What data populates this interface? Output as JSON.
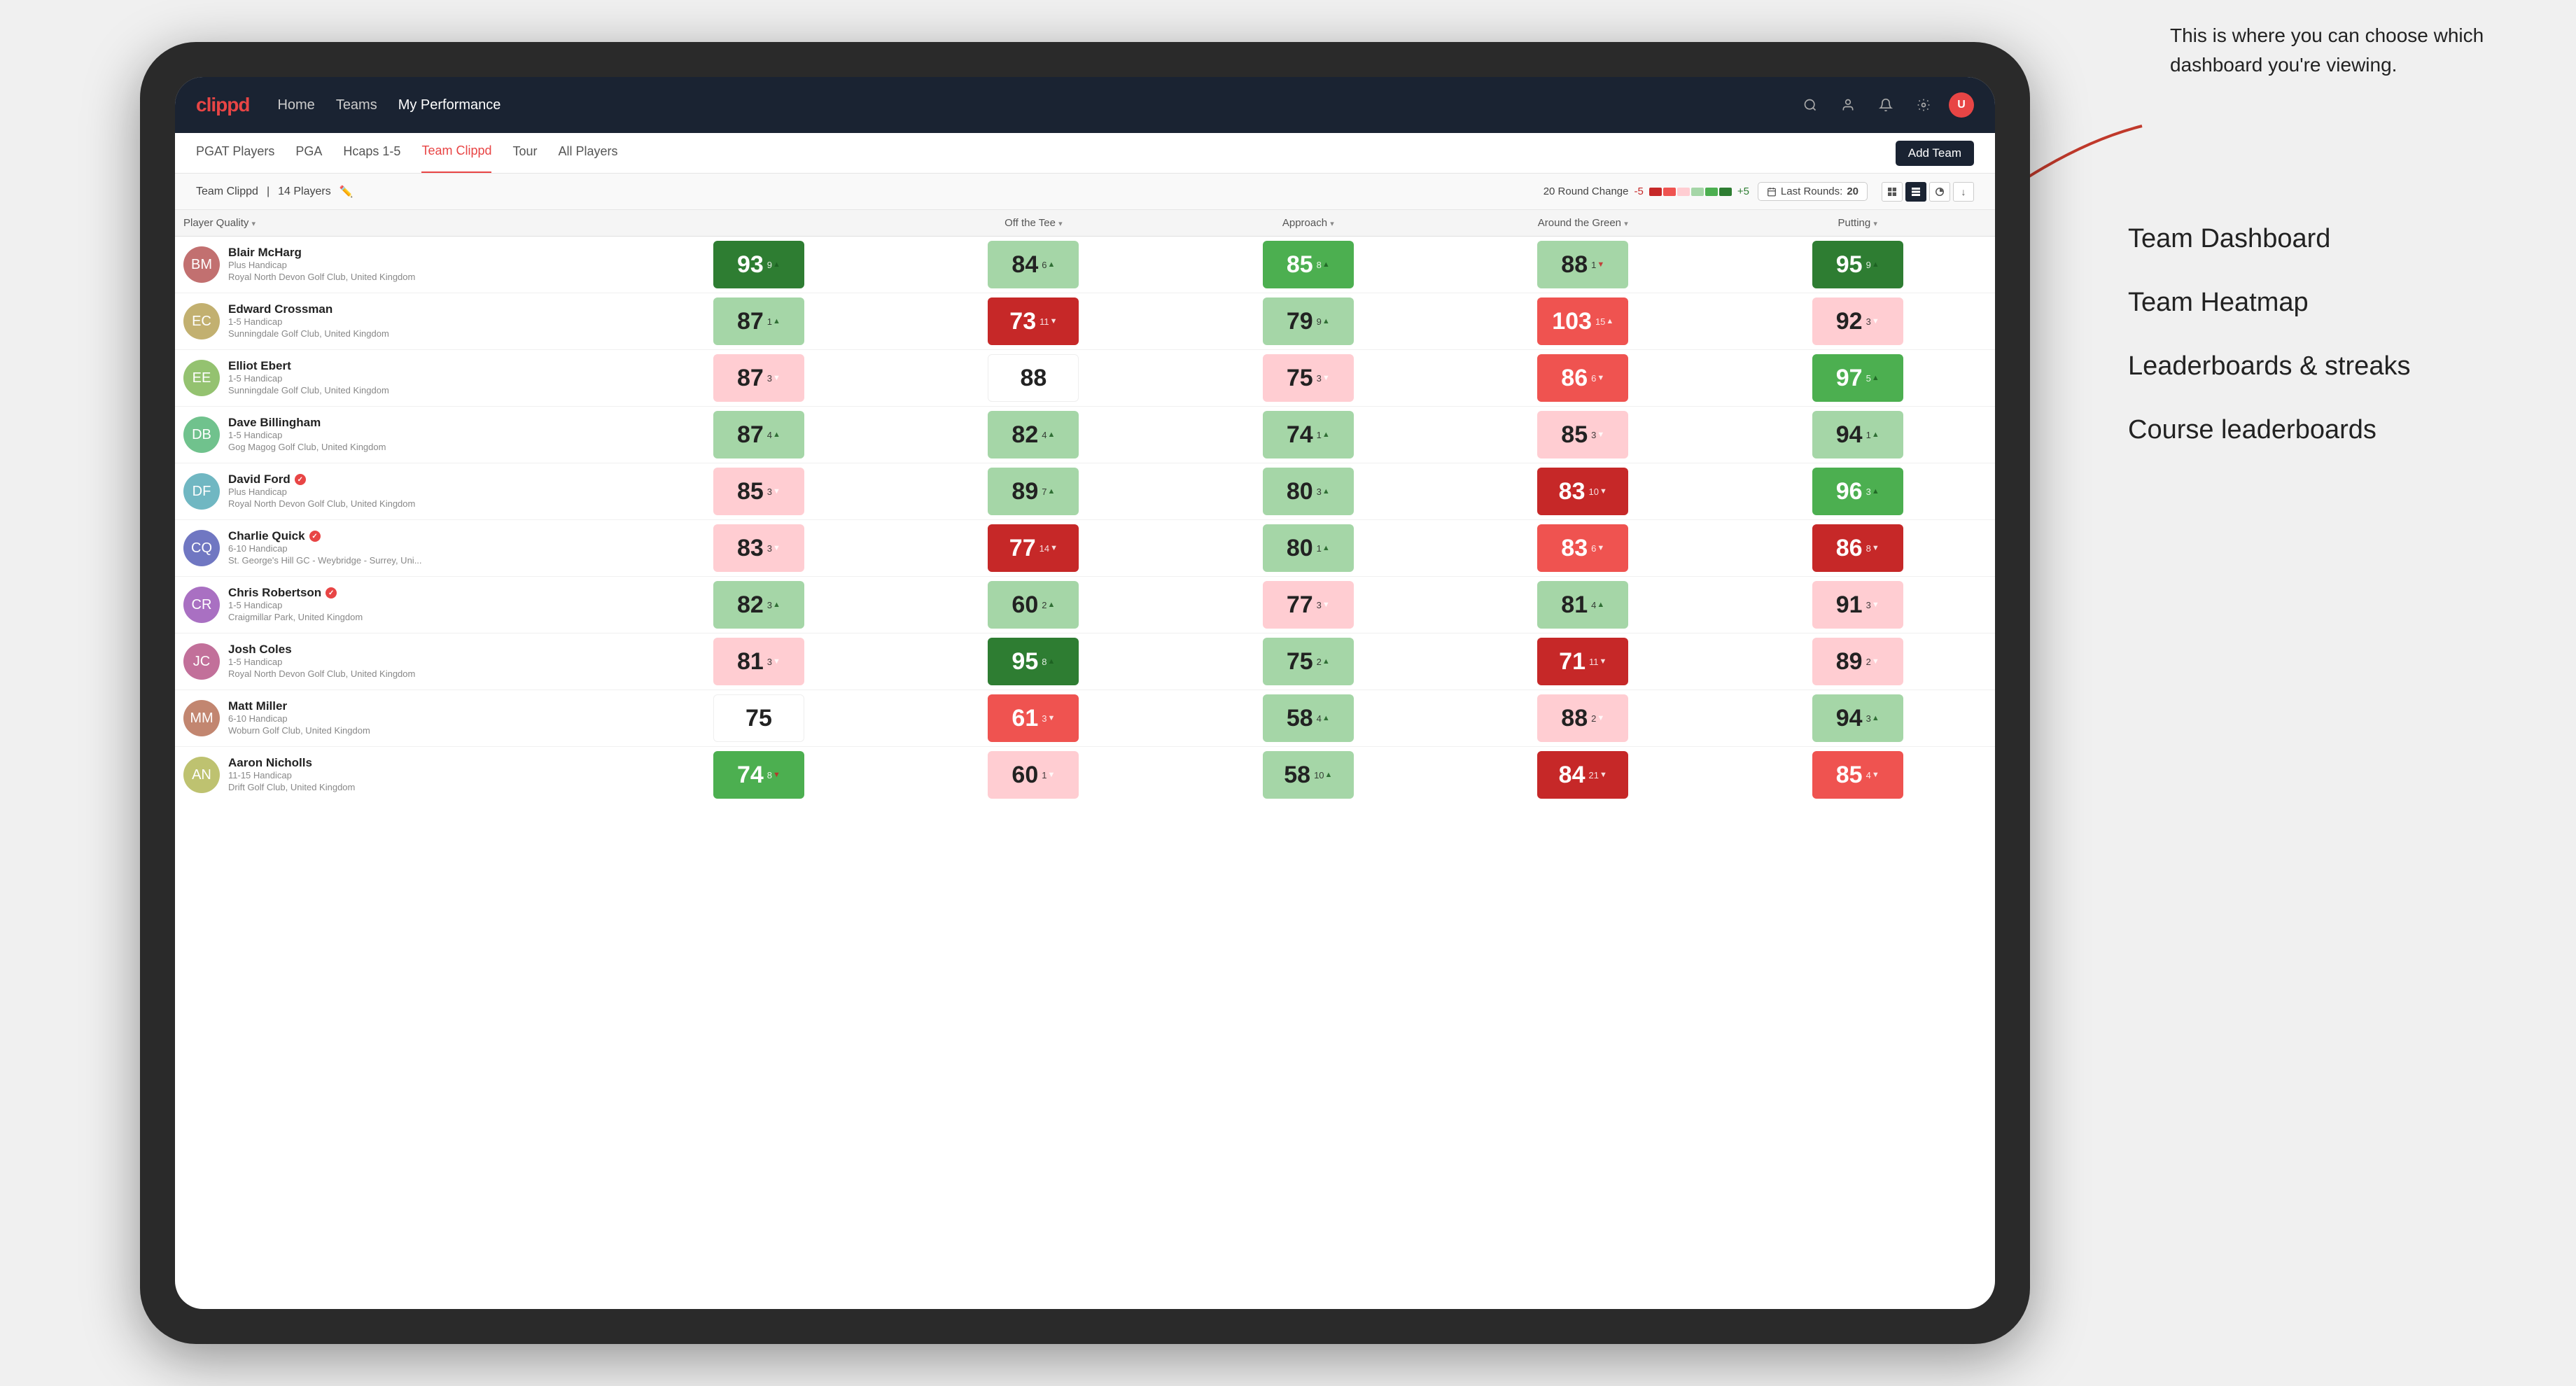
{
  "annotation": {
    "text": "This is where you can choose which dashboard you're viewing.",
    "options": [
      "Team Dashboard",
      "Team Heatmap",
      "Leaderboards & streaks",
      "Course leaderboards"
    ]
  },
  "nav": {
    "logo": "clippd",
    "items": [
      "Home",
      "Teams",
      "My Performance"
    ],
    "active": "My Performance"
  },
  "subnav": {
    "items": [
      "PGAT Players",
      "PGA",
      "Hcaps 1-5",
      "Team Clippd",
      "Tour",
      "All Players"
    ],
    "active": "Team Clippd",
    "add_team_label": "Add Team"
  },
  "team_header": {
    "name": "Team Clippd",
    "count": "14 Players",
    "round_change_label": "20 Round Change",
    "range_low": "-5",
    "range_high": "+5",
    "last_rounds_label": "Last Rounds:",
    "last_rounds_value": "20"
  },
  "columns": {
    "player": "Player Quality",
    "tee": "Off the Tee",
    "approach": "Approach",
    "around": "Around the Green",
    "putting": "Putting"
  },
  "players": [
    {
      "name": "Blair McHarg",
      "handicap": "Plus Handicap",
      "club": "Royal North Devon Golf Club, United Kingdom",
      "verified": false,
      "scores": {
        "quality": {
          "val": 93,
          "change": "+9",
          "dir": "up",
          "bg": "green-dark"
        },
        "tee": {
          "val": 84,
          "change": "+6",
          "dir": "up",
          "bg": "green-light"
        },
        "approach": {
          "val": 85,
          "change": "+8",
          "dir": "up",
          "bg": "green-mid"
        },
        "around": {
          "val": 88,
          "change": "-1",
          "dir": "down",
          "bg": "green-light"
        },
        "putting": {
          "val": 95,
          "change": "+9",
          "dir": "up",
          "bg": "green-dark"
        }
      }
    },
    {
      "name": "Edward Crossman",
      "handicap": "1-5 Handicap",
      "club": "Sunningdale Golf Club, United Kingdom",
      "verified": false,
      "scores": {
        "quality": {
          "val": 87,
          "change": "+1",
          "dir": "up",
          "bg": "green-light"
        },
        "tee": {
          "val": 73,
          "change": "-11",
          "dir": "down",
          "bg": "red-dark"
        },
        "approach": {
          "val": 79,
          "change": "+9",
          "dir": "up",
          "bg": "green-light"
        },
        "around": {
          "val": 103,
          "change": "+15",
          "dir": "up",
          "bg": "red-mid"
        },
        "putting": {
          "val": 92,
          "change": "-3",
          "dir": "down",
          "bg": "red-light"
        }
      }
    },
    {
      "name": "Elliot Ebert",
      "handicap": "1-5 Handicap",
      "club": "Sunningdale Golf Club, United Kingdom",
      "verified": false,
      "scores": {
        "quality": {
          "val": 87,
          "change": "-3",
          "dir": "down",
          "bg": "red-light"
        },
        "tee": {
          "val": 88,
          "change": "",
          "dir": "",
          "bg": "white"
        },
        "approach": {
          "val": 75,
          "change": "-3",
          "dir": "down",
          "bg": "red-light"
        },
        "around": {
          "val": 86,
          "change": "-6",
          "dir": "down",
          "bg": "red-mid"
        },
        "putting": {
          "val": 97,
          "change": "+5",
          "dir": "up",
          "bg": "green-mid"
        }
      }
    },
    {
      "name": "Dave Billingham",
      "handicap": "1-5 Handicap",
      "club": "Gog Magog Golf Club, United Kingdom",
      "verified": false,
      "scores": {
        "quality": {
          "val": 87,
          "change": "+4",
          "dir": "up",
          "bg": "green-light"
        },
        "tee": {
          "val": 82,
          "change": "+4",
          "dir": "up",
          "bg": "green-light"
        },
        "approach": {
          "val": 74,
          "change": "+1",
          "dir": "up",
          "bg": "green-light"
        },
        "around": {
          "val": 85,
          "change": "-3",
          "dir": "down",
          "bg": "red-light"
        },
        "putting": {
          "val": 94,
          "change": "+1",
          "dir": "up",
          "bg": "green-light"
        }
      }
    },
    {
      "name": "David Ford",
      "handicap": "Plus Handicap",
      "club": "Royal North Devon Golf Club, United Kingdom",
      "verified": true,
      "scores": {
        "quality": {
          "val": 85,
          "change": "-3",
          "dir": "down",
          "bg": "red-light"
        },
        "tee": {
          "val": 89,
          "change": "+7",
          "dir": "up",
          "bg": "green-light"
        },
        "approach": {
          "val": 80,
          "change": "+3",
          "dir": "up",
          "bg": "green-light"
        },
        "around": {
          "val": 83,
          "change": "-10",
          "dir": "down",
          "bg": "red-dark"
        },
        "putting": {
          "val": 96,
          "change": "+3",
          "dir": "up",
          "bg": "green-mid"
        }
      }
    },
    {
      "name": "Charlie Quick",
      "handicap": "6-10 Handicap",
      "club": "St. George's Hill GC - Weybridge - Surrey, Uni...",
      "verified": true,
      "scores": {
        "quality": {
          "val": 83,
          "change": "-3",
          "dir": "down",
          "bg": "red-light"
        },
        "tee": {
          "val": 77,
          "change": "-14",
          "dir": "down",
          "bg": "red-dark"
        },
        "approach": {
          "val": 80,
          "change": "+1",
          "dir": "up",
          "bg": "green-light"
        },
        "around": {
          "val": 83,
          "change": "-6",
          "dir": "down",
          "bg": "red-mid"
        },
        "putting": {
          "val": 86,
          "change": "-8",
          "dir": "down",
          "bg": "red-dark"
        }
      }
    },
    {
      "name": "Chris Robertson",
      "handicap": "1-5 Handicap",
      "club": "Craigmillar Park, United Kingdom",
      "verified": true,
      "scores": {
        "quality": {
          "val": 82,
          "change": "+3",
          "dir": "up",
          "bg": "green-light"
        },
        "tee": {
          "val": 60,
          "change": "+2",
          "dir": "up",
          "bg": "green-light"
        },
        "approach": {
          "val": 77,
          "change": "-3",
          "dir": "down",
          "bg": "red-light"
        },
        "around": {
          "val": 81,
          "change": "+4",
          "dir": "up",
          "bg": "green-light"
        },
        "putting": {
          "val": 91,
          "change": "-3",
          "dir": "down",
          "bg": "red-light"
        }
      }
    },
    {
      "name": "Josh Coles",
      "handicap": "1-5 Handicap",
      "club": "Royal North Devon Golf Club, United Kingdom",
      "verified": false,
      "scores": {
        "quality": {
          "val": 81,
          "change": "-3",
          "dir": "down",
          "bg": "red-light"
        },
        "tee": {
          "val": 95,
          "change": "+8",
          "dir": "up",
          "bg": "green-dark"
        },
        "approach": {
          "val": 75,
          "change": "+2",
          "dir": "up",
          "bg": "green-light"
        },
        "around": {
          "val": 71,
          "change": "-11",
          "dir": "down",
          "bg": "red-dark"
        },
        "putting": {
          "val": 89,
          "change": "-2",
          "dir": "down",
          "bg": "red-light"
        }
      }
    },
    {
      "name": "Matt Miller",
      "handicap": "6-10 Handicap",
      "club": "Woburn Golf Club, United Kingdom",
      "verified": false,
      "scores": {
        "quality": {
          "val": 75,
          "change": "",
          "dir": "",
          "bg": "white"
        },
        "tee": {
          "val": 61,
          "change": "-3",
          "dir": "down",
          "bg": "red-mid"
        },
        "approach": {
          "val": 58,
          "change": "+4",
          "dir": "up",
          "bg": "green-light"
        },
        "around": {
          "val": 88,
          "change": "-2",
          "dir": "down",
          "bg": "red-light"
        },
        "putting": {
          "val": 94,
          "change": "+3",
          "dir": "up",
          "bg": "green-light"
        }
      }
    },
    {
      "name": "Aaron Nicholls",
      "handicap": "11-15 Handicap",
      "club": "Drift Golf Club, United Kingdom",
      "verified": false,
      "scores": {
        "quality": {
          "val": 74,
          "change": "-8",
          "dir": "down",
          "bg": "green-mid"
        },
        "tee": {
          "val": 60,
          "change": "-1",
          "dir": "down",
          "bg": "red-light"
        },
        "approach": {
          "val": 58,
          "change": "+10",
          "dir": "up",
          "bg": "green-light"
        },
        "around": {
          "val": 84,
          "change": "-21",
          "dir": "down",
          "bg": "red-dark"
        },
        "putting": {
          "val": 85,
          "change": "-4",
          "dir": "down",
          "bg": "red-mid"
        }
      }
    }
  ],
  "colors": {
    "green_dark": "#2e7d32",
    "green_mid": "#4caf50",
    "green_light": "#a5d6a7",
    "red_dark": "#c62828",
    "red_mid": "#ef5350",
    "red_light": "#ffcdd2",
    "nav_bg": "#1a2332",
    "accent": "#e84545"
  }
}
